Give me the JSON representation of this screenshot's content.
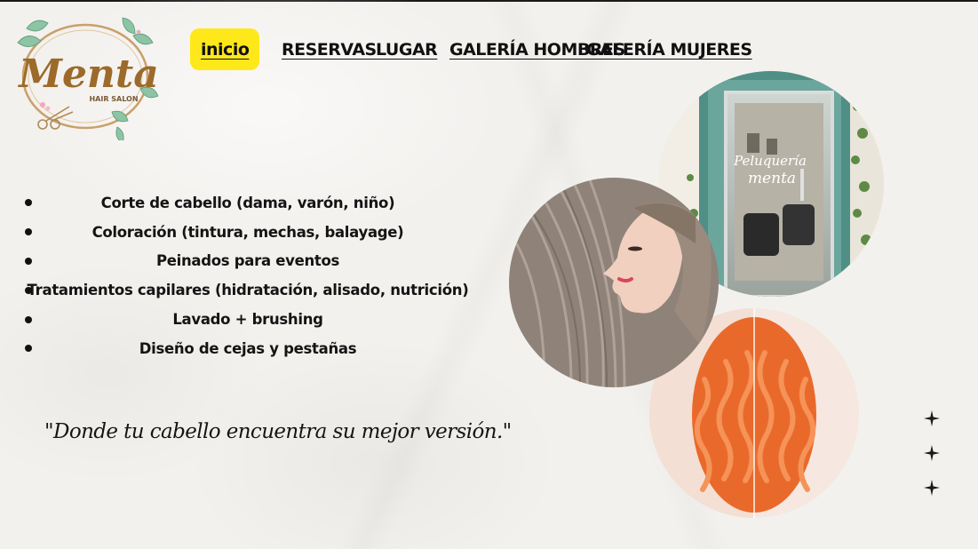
{
  "brand": {
    "logo_text": "Menta",
    "logo_subtitle": "HAIR SALON",
    "logo_colors": {
      "gold": "#a5752c",
      "leaf": "#7fb79a"
    }
  },
  "nav": {
    "items": [
      {
        "label": "inicio",
        "active": true
      },
      {
        "label": "RESERVAS",
        "active": false
      },
      {
        "label": "LUGAR",
        "active": false
      },
      {
        "label": "GALERÍA HOMBRES",
        "active": false
      },
      {
        "label": "GALERÍA MUJERES",
        "active": false
      }
    ],
    "active_color": "#ffe81a"
  },
  "services": [
    "Corte de cabello (dama, varón, niño)",
    "Coloración (tintura, mechas, balayage)",
    "Peinados para eventos",
    "Tratamientos capilares (hidratación, alisado, nutrición)",
    "Lavado + brushing",
    "Diseño de cejas y pestañas"
  ],
  "quote": "\"Donde tu cabello encuentra su mejor versión.\"",
  "photos": {
    "salon_door": {
      "sign_line1": "Peluquería",
      "sign_line2": "menta",
      "icon": "salon-door-photo"
    },
    "woman_profile": {
      "icon": "woman-hair-photo"
    },
    "ginger_hair": {
      "icon": "ginger-hair-photo"
    }
  },
  "decor": {
    "sparkle_icon": "sparkle-icon",
    "sparkle_count": 3
  }
}
